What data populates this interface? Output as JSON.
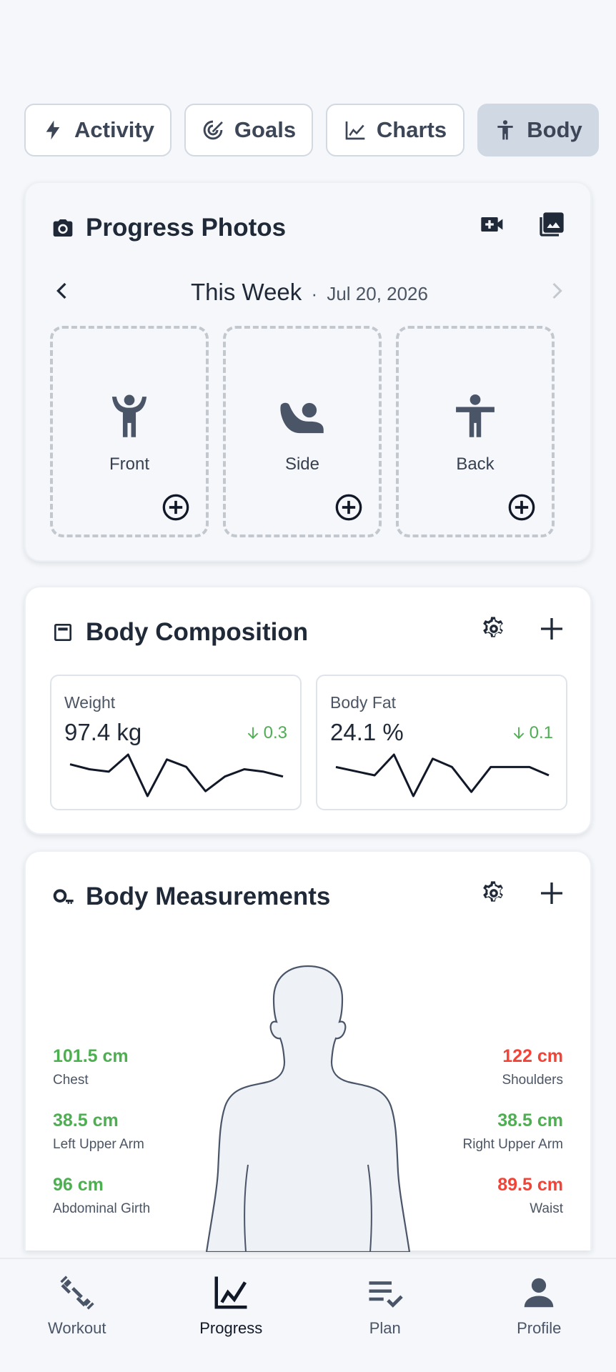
{
  "tabs": [
    {
      "label": "Activity",
      "icon": "bolt-icon",
      "active": false
    },
    {
      "label": "Goals",
      "icon": "target-icon",
      "active": false
    },
    {
      "label": "Charts",
      "icon": "line-chart-icon",
      "active": false
    },
    {
      "label": "Body",
      "icon": "body-icon",
      "active": true
    }
  ],
  "photos": {
    "title": "Progress Photos",
    "week_label": "This Week",
    "separator": "·",
    "week_date": "Jul 20, 2026",
    "slots": [
      {
        "label": "Front",
        "icon": "front-pose-icon"
      },
      {
        "label": "Side",
        "icon": "side-pose-icon"
      },
      {
        "label": "Back",
        "icon": "back-pose-icon"
      }
    ]
  },
  "composition": {
    "title": "Body Composition",
    "tiles": [
      {
        "label": "Weight",
        "value": "97.4 kg",
        "delta": "0.3",
        "trend": [
          97.9,
          97.7,
          97.6,
          98.3,
          96.6,
          98.1,
          97.8,
          96.8,
          97.4,
          97.7,
          97.6,
          97.4
        ]
      },
      {
        "label": "Body Fat",
        "value": "24.1 %",
        "delta": "0.1",
        "trend": [
          24.6,
          24.5,
          24.4,
          24.9,
          23.9,
          24.8,
          24.6,
          24.0,
          24.6,
          24.6,
          24.6,
          24.4
        ]
      }
    ]
  },
  "measurements": {
    "title": "Body Measurements",
    "left": [
      {
        "value": "101.5 cm",
        "label": "Chest",
        "color": "#4caf50"
      },
      {
        "value": "38.5 cm",
        "label": "Left Upper Arm",
        "color": "#4caf50"
      },
      {
        "value": "96 cm",
        "label": "Abdominal Girth",
        "color": "#4caf50"
      }
    ],
    "right": [
      {
        "value": "122 cm",
        "label": "Shoulders",
        "color": "#f44336"
      },
      {
        "value": "38.5 cm",
        "label": "Right Upper Arm",
        "color": "#4caf50"
      },
      {
        "value": "89.5 cm",
        "label": "Waist",
        "color": "#f44336"
      }
    ]
  },
  "nav": [
    {
      "label": "Workout",
      "icon": "dumbbell-icon",
      "active": false
    },
    {
      "label": "Progress",
      "icon": "progress-chart-icon",
      "active": true
    },
    {
      "label": "Plan",
      "icon": "checklist-icon",
      "active": false
    },
    {
      "label": "Profile",
      "icon": "person-icon",
      "active": false
    }
  ],
  "colors": {
    "positive": "#4caf50",
    "negative": "#f44336",
    "active_tab": "#cfd8e3"
  }
}
